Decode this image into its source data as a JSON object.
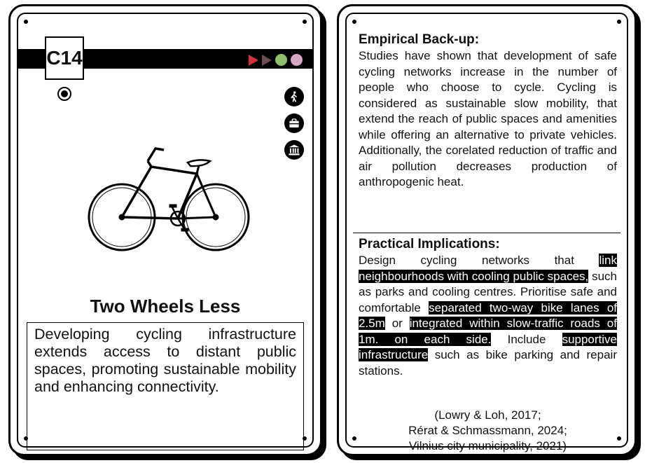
{
  "card": {
    "code": "C14",
    "title": "Two Wheels Less",
    "description": "Developing cycling infrastructure extends access to distant public spaces, promoting sustainable mobility and enhancing connectivity.",
    "markers": [
      "red-triangle",
      "brown-triangle",
      "green-circle",
      "pink-circle"
    ],
    "marker_colors": {
      "red": "#d32f3b",
      "brown": "#6d4b52",
      "green": "#8fbf6a",
      "pink": "#d7a6c4"
    },
    "icons": [
      "target-icon",
      "walking-person-icon",
      "briefcase-icon",
      "museum-icon"
    ]
  },
  "back": {
    "empirical": {
      "heading": "Empirical Back-up:",
      "text": "Studies have shown that development of safe cycling networks increase in the number of people who choose to cycle. Cycling is considered as sustainable slow mobility, that extend the reach of public spaces and amenities while offering an alternative to private vehicles. Additionally, the corelated reduction of traffic and air pollution decreases production of anthropogenic heat."
    },
    "practical": {
      "heading": "Practical Implications:",
      "seg1": "Design cycling networks that ",
      "hl1": "link neighbourhoods with cooling public spaces,",
      "seg2": " such as parks and cooling centres. Prioritise safe and comfortable ",
      "hl2": "separated two-way bike lanes of 2.5m",
      "seg3": " or ",
      "hl3": "integrated within slow-traffic roads of 1m. on each side.",
      "seg4": " Include ",
      "hl4": "supportive infrastructure",
      "seg5": " such as bike parking and repair stations."
    },
    "references": [
      "(Lowry & Loh, 2017;",
      "Rérat & Schmassmann, 2024;",
      "Vilnius city municipality, 2021)"
    ]
  }
}
